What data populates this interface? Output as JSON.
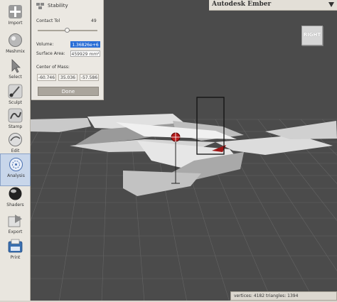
{
  "app": {
    "title": "Autodesk Ember"
  },
  "toolbar": {
    "items": [
      {
        "label": "Import",
        "icon": "plus-icon"
      },
      {
        "label": "Meshmix",
        "icon": "meshmix-sphere-icon"
      },
      {
        "label": "Select",
        "icon": "select-arrow-icon"
      },
      {
        "label": "Sculpt",
        "icon": "sculpt-brush-icon"
      },
      {
        "label": "Stamp",
        "icon": "stamp-icon"
      },
      {
        "label": "Edit",
        "icon": "edit-icon"
      },
      {
        "label": "Analysis",
        "icon": "analysis-icon",
        "active": true
      },
      {
        "label": "Shaders",
        "icon": "shaders-sphere-icon"
      },
      {
        "label": "Export",
        "icon": "export-icon"
      },
      {
        "label": "Print",
        "icon": "print-icon"
      }
    ]
  },
  "panel": {
    "title": "Stability",
    "contact_tol": {
      "label": "Contact Tol",
      "value": "49",
      "fraction": 0.49
    },
    "volume": {
      "label": "Volume:",
      "value": "1.36826e+6"
    },
    "surface_area": {
      "label": "Surface Area:",
      "value": "459929 mm²"
    },
    "center_of_mass": {
      "label": "Center of Mass:",
      "values": [
        "-60.746",
        "35.036",
        "-57.586"
      ]
    },
    "done_label": "Done"
  },
  "viewcube": {
    "label": "RIGHT"
  },
  "status": {
    "text": "vertices: 4182 triangles: 1394"
  },
  "colors": {
    "viewport_bg": "#4c4c4c",
    "grid": "#6a6a6a",
    "model_light": "#d2d2d2",
    "model_dark": "#8e8e8e",
    "selection_blue": "#2b6fd6",
    "com_marker": "#b41a1a",
    "panel_bg": "#ebe8e2",
    "toolbar_active": "#c8d6ea"
  }
}
